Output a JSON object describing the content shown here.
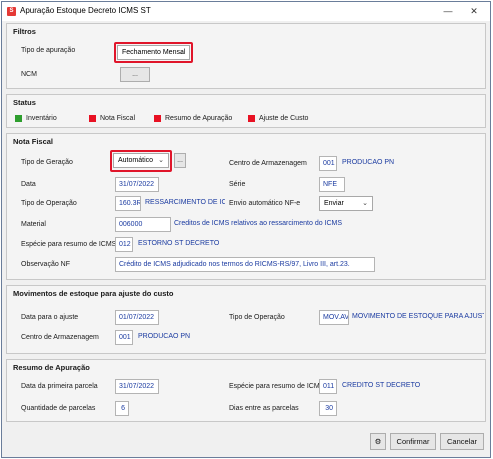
{
  "window": {
    "title": "Apuração Estoque Decreto ICMS ST",
    "app_icon": "app-logo-icon",
    "minimize_glyph": "—",
    "close_glyph": "✕"
  },
  "filtros": {
    "title": "Filtros",
    "tipo_apuracao_label": "Tipo de apuração",
    "tipo_apuracao_value": "Fechamento Mensal",
    "ncm_label": "NCM",
    "ncm_button": "..."
  },
  "status": {
    "title": "Status",
    "items": [
      {
        "label": "Inventário",
        "color": "#2e9e2e"
      },
      {
        "label": "Nota Fiscal",
        "color": "#e81123"
      },
      {
        "label": "Resumo de Apuração",
        "color": "#e81123"
      },
      {
        "label": "Ajuste de Custo",
        "color": "#e81123"
      }
    ]
  },
  "nota_fiscal": {
    "title": "Nota Fiscal",
    "tipo_geracao_label": "Tipo de Geração",
    "tipo_geracao_value": "Automático",
    "tipo_geracao_button": "...",
    "centro_label": "Centro de Armazenagem",
    "centro_code": "001",
    "centro_desc": "PRODUCAO PN",
    "data_label": "Data",
    "data_value": "31/07/2022",
    "serie_label": "Série",
    "serie_value": "NFE",
    "tipo_operacao_label": "Tipo de Operação",
    "tipo_operacao_code": "160.3R",
    "tipo_operacao_desc": "RESSARCIMENTO DE ICMS I",
    "envio_label": "Envio automático NF-e",
    "envio_value": "Enviar",
    "material_label": "Material",
    "material_code": "006000",
    "material_desc": "Creditos de ICMS relativos ao ressarcimento do ICMS",
    "especie_label": "Espécie para resumo de ICMS",
    "especie_code": "012",
    "especie_desc": "ESTORNO ST DECRETO",
    "observacao_label": "Observação NF",
    "observacao_value": "Crédito de ICMS adjudicado nos termos do RICMS-RS/97, Livro III, art.23."
  },
  "movimentos": {
    "title": "Movimentos de estoque para ajuste do custo",
    "data_label": "Data para o ajuste",
    "data_value": "01/07/2022",
    "tipo_operacao_label": "Tipo de Operação",
    "tipo_operacao_code": "MOV.AV",
    "tipo_operacao_desc": "MOVIMENTO DE ESTOQUE PARA AJUSTE CUS",
    "centro_label": "Centro de Armazenagem",
    "centro_code": "001",
    "centro_desc": "PRODUCAO PN"
  },
  "resumo": {
    "title": "Resumo de Apuração",
    "data_primeira_label": "Data da primeira parcela",
    "data_primeira_value": "31/07/2022",
    "especie_label": "Espécie para resumo de ICMS",
    "especie_code": "011",
    "especie_desc": "CREDITO ST DECRETO",
    "qtd_parcelas_label": "Quantidade de parcelas",
    "qtd_parcelas_value": "6",
    "dias_label": "Dias entre as parcelas",
    "dias_value": "30"
  },
  "footer": {
    "settings_icon": "gear-icon",
    "confirmar": "Confirmar",
    "cancelar": "Cancelar"
  }
}
